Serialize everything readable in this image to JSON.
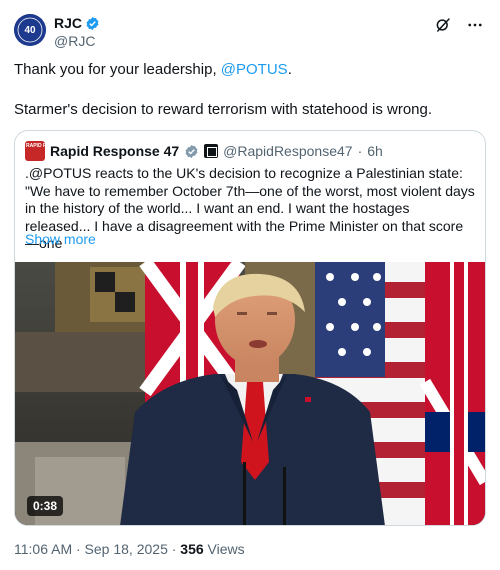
{
  "author": {
    "display_name": "RJC",
    "handle": "@RJC",
    "avatar_text": "40"
  },
  "tweet": {
    "line1_prefix": "Thank you for your leadership, ",
    "line1_mention": "@POTUS",
    "line1_suffix": ".",
    "line2": "Starmer's decision to reward terrorism with statehood is wrong."
  },
  "quote": {
    "display_name": "Rapid Response 47",
    "handle": "@RapidResponse47",
    "separator": "·",
    "time": "6h",
    "avatar_text": "RAPID RESPONSE",
    "text": ".@POTUS reacts to the UK's decision to recognize a Palestinian state: \"We have to remember October 7th—one of the worst, most violent days in the history of the world... I want an end. I want the hostages released... I have a disagreement with the Prime Minister on that score—one",
    "show_more": "Show more",
    "video_duration": "0:38"
  },
  "meta": {
    "timestamp": "11:06 AM · Sep 18, 2025 · ",
    "views_count": "356",
    "views_label": " Views"
  },
  "icons": {
    "verified": "verified-badge-icon",
    "grok": "grok-icon",
    "more": "more-icon",
    "government": "government-badge-icon"
  },
  "colors": {
    "accent": "#1d9bf0",
    "verified": "#1d9bf0",
    "text": "#0f1419",
    "secondary": "#536471",
    "border": "#cfd9de"
  }
}
